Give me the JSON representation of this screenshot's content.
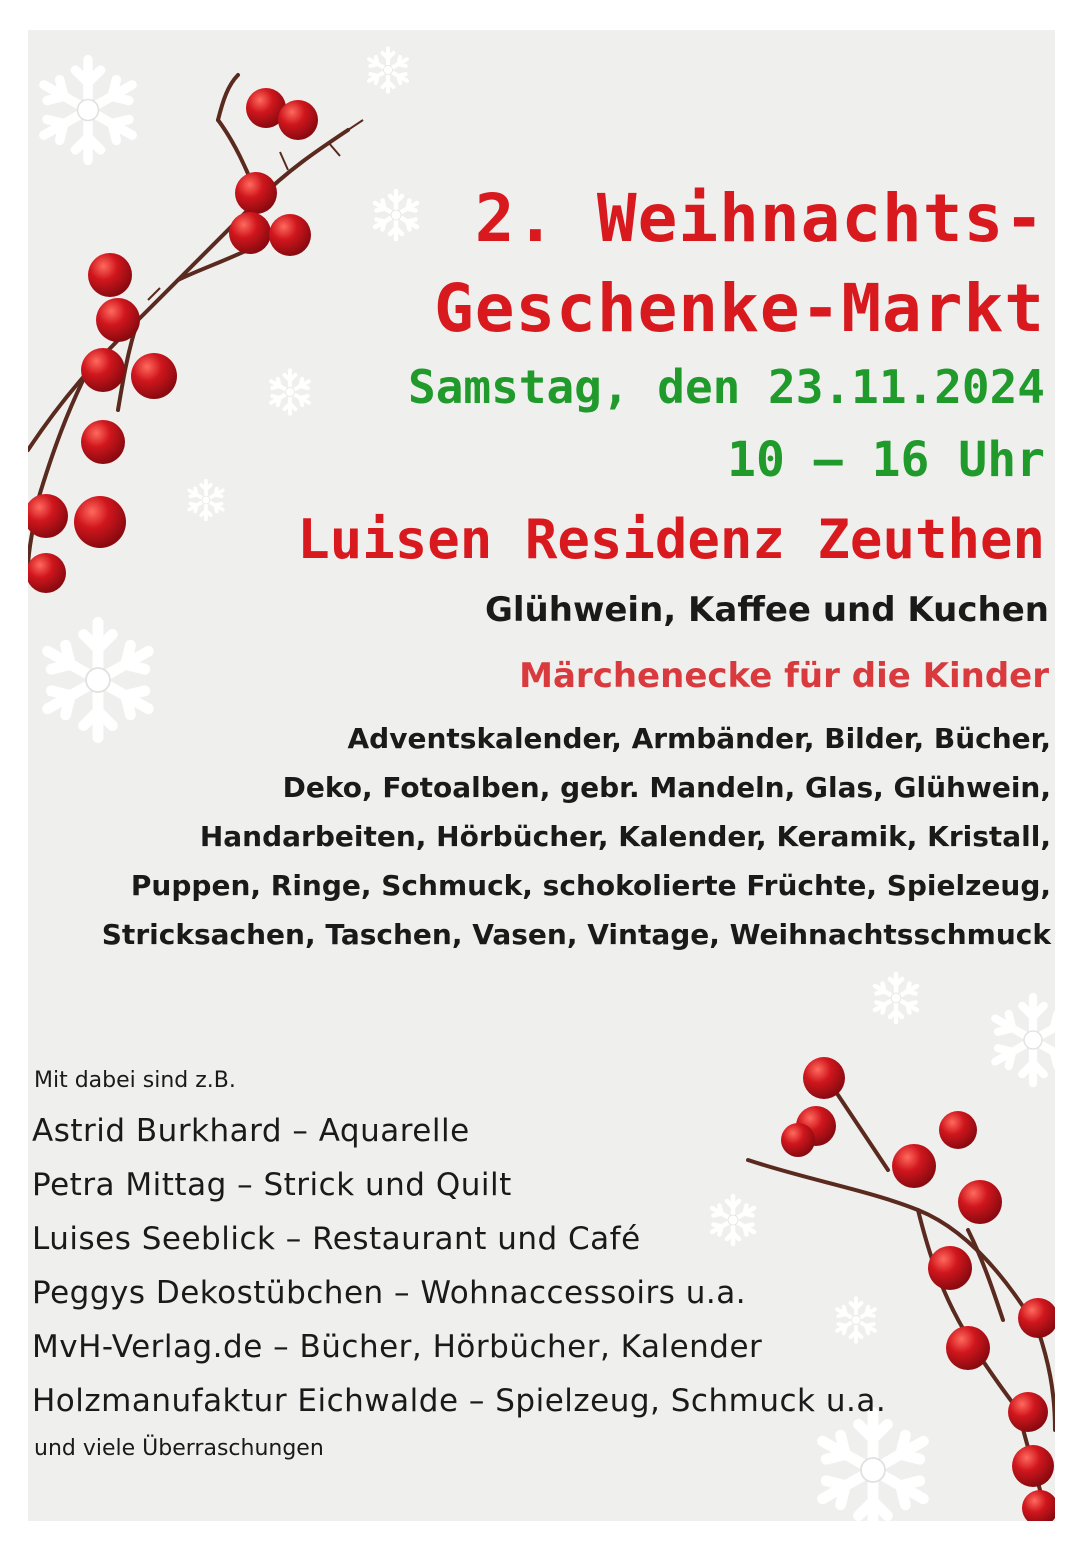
{
  "poster": {
    "title_line1": "2. Weihnachts-",
    "title_line2": "Geschenke-Markt",
    "date": "Samstag, den 23.11.2024",
    "time": "10 – 16 Uhr",
    "venue": "Luisen Residenz Zeuthen",
    "refreshments": "Glühwein, Kaffee und Kuchen",
    "kids_corner": "Märchenecke für die Kinder",
    "items": [
      "Adventskalender, Armbänder, Bilder, Bücher,",
      "Deko, Fotoalben, gebr. Mandeln, Glas, Glühwein,",
      "Handarbeiten, Hörbücher, Kalender, Keramik, Kristall,",
      "Puppen, Ringe, Schmuck, schokolierte Früchte, Spielzeug,",
      "Stricksachen, Taschen, Vasen, Vintage, Weihnachtsschmuck"
    ],
    "vendors_intro": "Mit dabei sind z.B.",
    "vendors": [
      "Astrid Burkhard – Aquarelle",
      "Petra Mittag – Strick und Quilt",
      "Luises Seeblick – Restaurant und Café",
      "Peggys Dekostübchen – Wohnaccessoirs u.a.",
      "MvH-Verlag.de – Bücher, Hörbücher, Kalender",
      "Holzmanufaktur Eichwalde – Spielzeug, Schmuck u.a."
    ],
    "closing": "und viele Überraschungen"
  },
  "colors": {
    "title_red": "#d81a1f",
    "date_green": "#1f9a2b",
    "berry_red": "#c8141c",
    "background": "#efefee"
  },
  "decorations": [
    "snowflake-icon",
    "berry-branch-icon"
  ]
}
